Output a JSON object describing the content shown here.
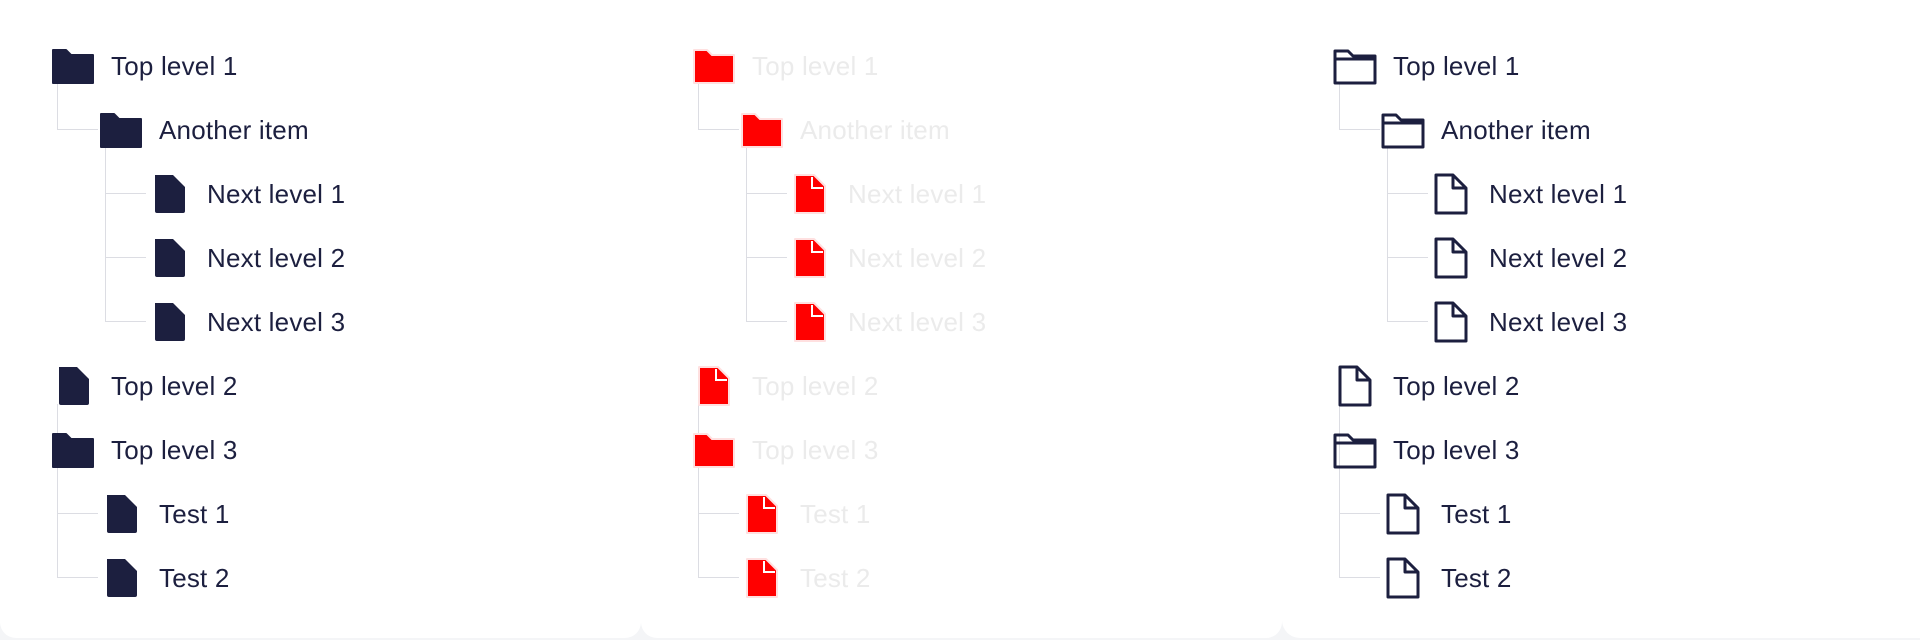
{
  "colors": {
    "ink": "#1c1f3f",
    "accent": "#ff0000",
    "faded_text": "#ebebeb",
    "guide": "#dcdde3"
  },
  "variants": [
    {
      "name": "filled",
      "icon_style": "filled-dark"
    },
    {
      "name": "disabled",
      "icon_style": "filled-red"
    },
    {
      "name": "outline",
      "icon_style": "outline-dark"
    }
  ],
  "tree": {
    "top1": {
      "label": "Top level 1",
      "icon": "folder-icon"
    },
    "another": {
      "label": "Another item",
      "icon": "folder-icon"
    },
    "next1": {
      "label": "Next level 1",
      "icon": "file-icon"
    },
    "next2": {
      "label": "Next level 2",
      "icon": "file-icon"
    },
    "next3": {
      "label": "Next level 3",
      "icon": "file-icon"
    },
    "top2": {
      "label": "Top level 2",
      "icon": "file-icon"
    },
    "top3": {
      "label": "Top level 3",
      "icon": "folder-icon"
    },
    "test1": {
      "label": "Test 1",
      "icon": "file-icon"
    },
    "test2": {
      "label": "Test 2",
      "icon": "file-icon"
    }
  }
}
